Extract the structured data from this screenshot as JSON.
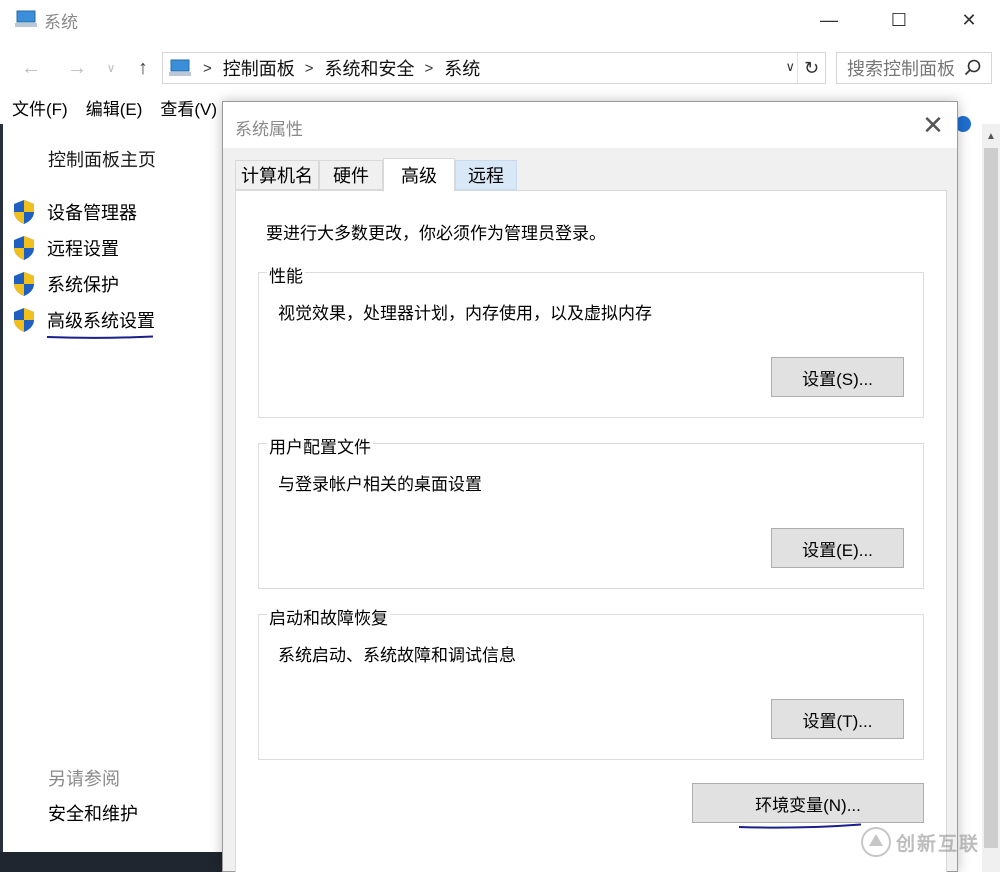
{
  "window": {
    "title": "系统",
    "controls": {
      "minimize": "—",
      "maximize": "☐",
      "close": "✕"
    }
  },
  "nav": {
    "back": "←",
    "forward": "→",
    "recent": "∨",
    "up": "↑",
    "breadcrumbs": [
      "控制面板",
      "系统和安全",
      "系统"
    ],
    "refresh": "↻",
    "dropdown": "∨",
    "search_placeholder": "搜索控制面板"
  },
  "menu": [
    "文件(F)",
    "编辑(E)",
    "查看(V)"
  ],
  "left_pane": {
    "home": "控制面板主页",
    "tasks": [
      "设备管理器",
      "远程设置",
      "系统保护",
      "高级系统设置"
    ],
    "see_also_title": "另请参阅",
    "see_also_items": [
      "安全和维护"
    ]
  },
  "dialog": {
    "title": "系统属性",
    "close": "✕",
    "tabs": [
      "计算机名",
      "硬件",
      "高级",
      "远程"
    ],
    "active_tab": "高级",
    "admin_note": "要进行大多数更改，你必须作为管理员登录。",
    "groups": [
      {
        "title": "性能",
        "description": "视觉效果，处理器计划，内存使用，以及虚拟内存",
        "button": "设置(S)..."
      },
      {
        "title": "用户配置文件",
        "description": "与登录帐户相关的桌面设置",
        "button": "设置(E)..."
      },
      {
        "title": "启动和故障恢复",
        "description": "系统启动、系统故障和调试信息",
        "button": "设置(T)..."
      }
    ],
    "env_button": "环境变量(N)..."
  },
  "watermark": "创新互联",
  "colors": {
    "shield_blue": "#1f5fbf",
    "shield_yellow": "#f2c01d",
    "annotation_ink": "#1a1f8a",
    "active_tab_bg": "#ffffff",
    "hover_tab_bg": "#d8e8f7"
  }
}
